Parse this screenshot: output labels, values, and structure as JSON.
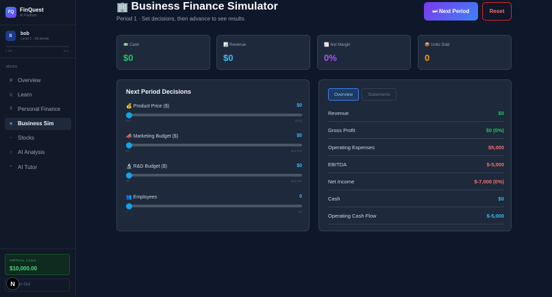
{
  "sidebar": {
    "brand_logo": "FQ",
    "brand_title": "FinQuest",
    "brand_sub": "AI Platform",
    "user_initial": "B",
    "user_name": "bob",
    "user_level": "Level 1 · 0d streak",
    "xp_left": "0 XP",
    "xp_right": "lv 2",
    "xp_progress": 0,
    "menu_label": "MENU",
    "items": [
      {
        "icon": "⊞",
        "label": "Overview"
      },
      {
        "icon": "◎",
        "label": "Learn"
      },
      {
        "icon": "$",
        "label": "Personal Finance"
      },
      {
        "icon": "◈",
        "label": "Business Sim"
      },
      {
        "icon": "~",
        "label": "Stocks"
      },
      {
        "icon": "◇",
        "label": "AI Analysis"
      },
      {
        "icon": "+",
        "label": "AI Tutor"
      }
    ],
    "virtual_cash_label": "VIRTUAL CASH",
    "virtual_cash_value": "$10,000.00",
    "signout_label": "gn Out",
    "badge": "N"
  },
  "header": {
    "icon": "🏢",
    "title": "Business Finance Simulator",
    "subtitle": "Period 1 · Set decisions, then advance to see results",
    "next_button": "⏭ Next Period",
    "reset_button": "Reset"
  },
  "stats": [
    {
      "icon": "💵",
      "label": "Cash",
      "value": "$0",
      "color": "#22c55e"
    },
    {
      "icon": "📊",
      "label": "Revenue",
      "value": "$0",
      "color": "#38bdf8"
    },
    {
      "icon": "📈",
      "label": "Net Margin",
      "value": "0%",
      "color": "#a855f7"
    },
    {
      "icon": "📦",
      "label": "Units Sold",
      "value": "0",
      "color": "#f59e0b"
    }
  ],
  "decisions": {
    "title": "Next Period Decisions",
    "sliders": [
      {
        "icon": "💰",
        "label": "Product Price ($)",
        "value": "$0",
        "min": "$10",
        "max": "$500",
        "fraction": 0
      },
      {
        "icon": "📣",
        "label": "Marketing Budget ($)",
        "value": "$0",
        "min": "$0",
        "max": "$50,000",
        "fraction": 0
      },
      {
        "icon": "🔬",
        "label": "R&D Budget ($)",
        "value": "$0",
        "min": "$0",
        "max": "$30,000",
        "fraction": 0
      },
      {
        "icon": "👥",
        "label": "Employees",
        "value": "0",
        "min": "1",
        "max": "50",
        "fraction": 0
      }
    ]
  },
  "results": {
    "tabs": [
      {
        "label": "Overview",
        "active": true
      },
      {
        "label": "Statements",
        "active": false
      }
    ],
    "rows": [
      {
        "label": "Revenue",
        "value": "$0",
        "color": "#22c55e"
      },
      {
        "label": "Gross Profit",
        "value": "$0 (0%)",
        "color": "#22c55e"
      },
      {
        "label": "Operating Expenses",
        "value": "$5,000",
        "color": "#f87171"
      },
      {
        "label": "EBITDA",
        "value": "$-5,000",
        "color": "#f87171"
      },
      {
        "label": "Net Income",
        "value": "$-7,000 (0%)",
        "color": "#f87171"
      },
      {
        "label": "Cash",
        "value": "$0",
        "color": "#38bdf8"
      },
      {
        "label": "Operating Cash Flow",
        "value": "$-5,000",
        "color": "#38bdf8"
      }
    ]
  }
}
